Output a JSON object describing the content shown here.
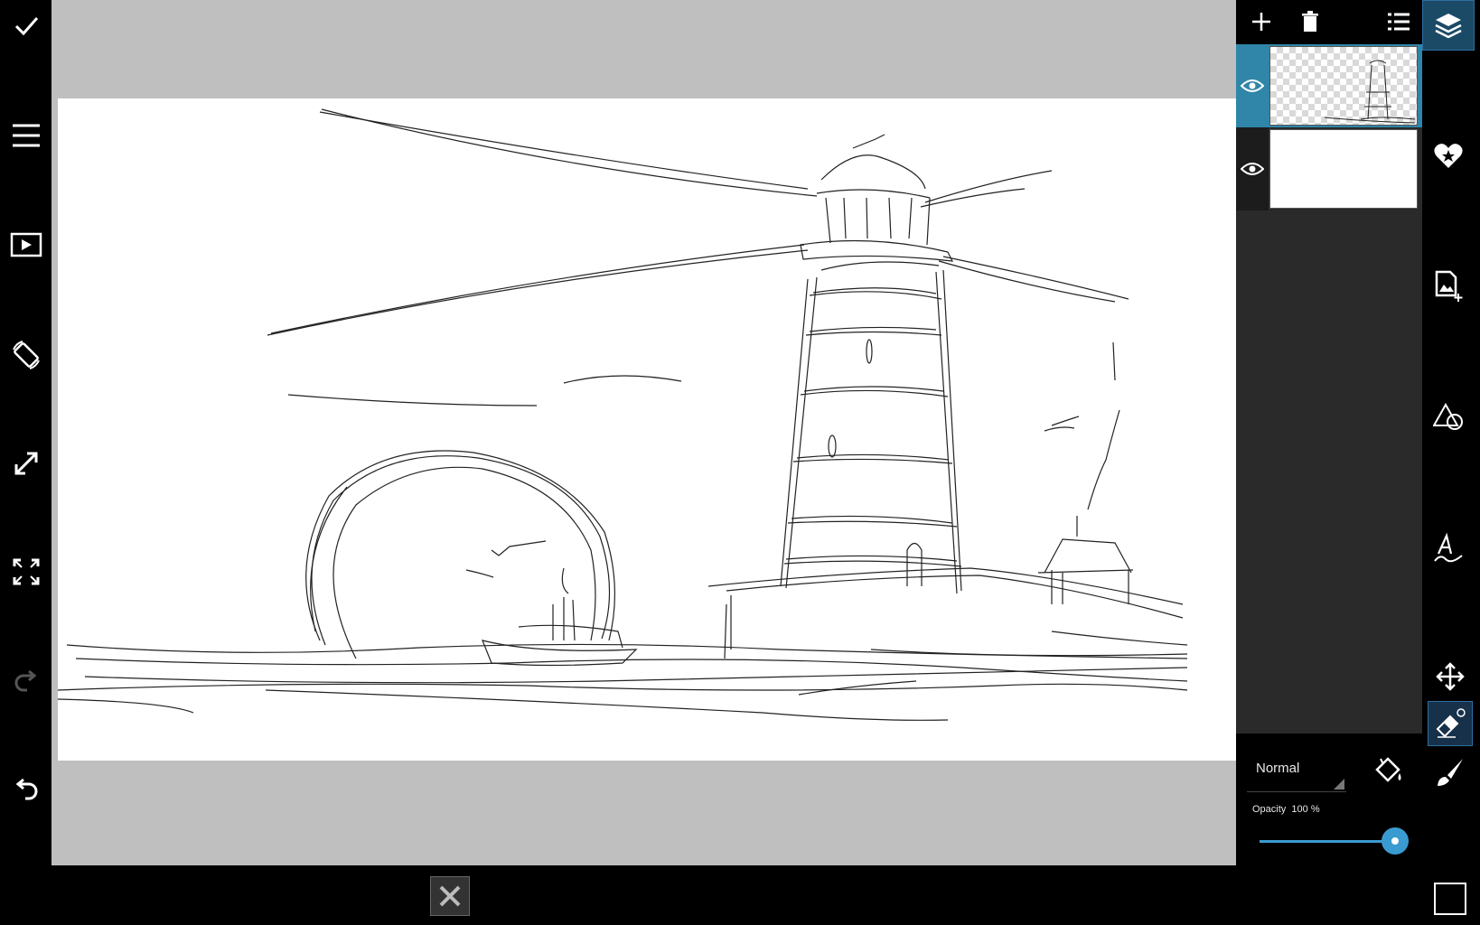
{
  "left_toolbar": {
    "items": [
      {
        "name": "confirm",
        "icon": "check-icon"
      },
      {
        "name": "menu",
        "icon": "hamburger-icon"
      },
      {
        "name": "play",
        "icon": "play-icon"
      },
      {
        "name": "rotate",
        "icon": "rotate-screen-icon"
      },
      {
        "name": "resize",
        "icon": "diagonal-arrow-icon"
      },
      {
        "name": "fullscreen",
        "icon": "expand-icon"
      },
      {
        "name": "redo",
        "icon": "redo-icon"
      },
      {
        "name": "undo",
        "icon": "undo-icon"
      },
      {
        "name": "close",
        "icon": "close-icon"
      }
    ]
  },
  "layers_toolbar": {
    "icons": [
      "plus-icon",
      "trash-icon",
      "list-icon"
    ]
  },
  "layers": [
    {
      "name": "layer-1",
      "visible": true,
      "selected": true,
      "thumbnail": "sketch"
    },
    {
      "name": "layer-2",
      "visible": true,
      "selected": false,
      "thumbnail": "blank"
    }
  ],
  "blend": {
    "mode": "Normal",
    "opacity_label": "Opacity",
    "opacity_value": "100 %",
    "opacity_fraction": 1.0
  },
  "right_toolbar": {
    "icons": [
      "layers-icon",
      "heart-star-icon",
      "add-image-icon",
      "shapes-icon",
      "text-icon",
      "move-icon",
      "eraser-icon",
      "brush-icon",
      "square-icon"
    ],
    "selected_tool": "eraser-icon"
  },
  "colors": {
    "accent": "#3a9bd0",
    "panel": "#2a2a2a",
    "canvas_bg": "#bfbfbf"
  }
}
